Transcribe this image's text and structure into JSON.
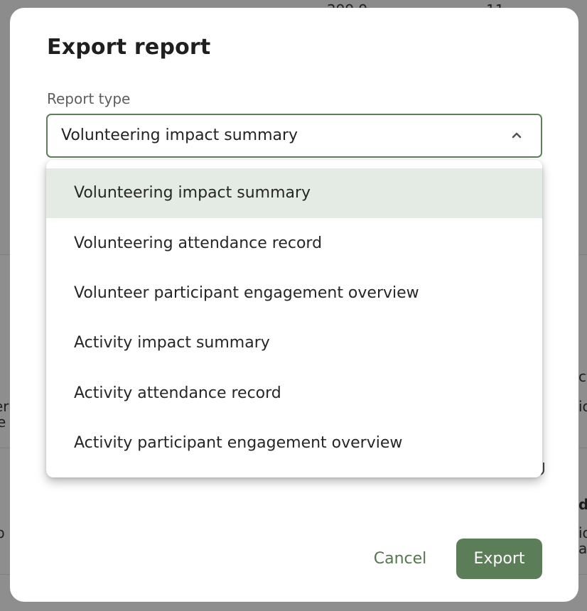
{
  "background": {
    "fragments": [
      "299.9",
      "11",
      "er",
      "e",
      "ct",
      "io",
      "p",
      "l",
      "d",
      "io",
      "at"
    ]
  },
  "dialog": {
    "title": "Export report",
    "field_label": "Report type",
    "selected_value": "Volunteering impact summary",
    "options": [
      "Volunteering impact summary",
      "Volunteering attendance record",
      "Volunteer participant engagement overview",
      "Activity impact summary",
      "Activity attendance record",
      "Activity participant engagement overview"
    ],
    "cancel_label": "Cancel",
    "export_label": "Export"
  },
  "colors": {
    "accent": "#5b7d58",
    "selected_option_bg": "#e4ebe4",
    "overlay": "#8e8e8e"
  },
  "icons": {
    "select_chevron": "chevron-up-icon"
  }
}
